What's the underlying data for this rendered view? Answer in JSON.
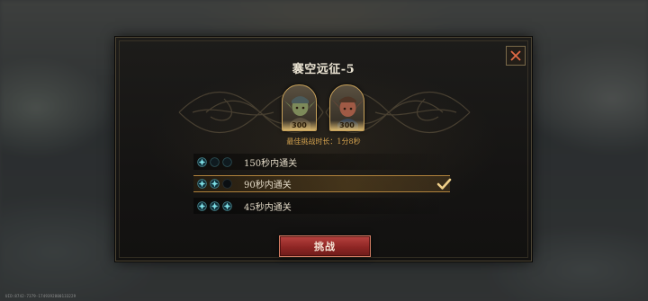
{
  "dialog": {
    "title": "褰空远征-5",
    "best_time": "最佳挑战时长：1分8秒"
  },
  "heroes": [
    {
      "icon": "goblin-warrior-portrait-icon",
      "power": "300"
    },
    {
      "icon": "goblin-rogue-portrait-icon",
      "power": "300"
    }
  ],
  "conditions": [
    {
      "label": "150秒内通关",
      "stars_filled": 1,
      "stars_total": 3,
      "selected": false
    },
    {
      "label": "90秒内通关",
      "stars_filled": 2,
      "stars_total": 3,
      "selected": true
    },
    {
      "label": "45秒内通关",
      "stars_filled": 3,
      "stars_total": 3,
      "selected": false
    }
  ],
  "buttons": {
    "challenge": "挑战",
    "close_icon": "close-x-icon"
  },
  "footer": {
    "build_code": "UID:8742-7379-1749392800133229"
  },
  "colors": {
    "accent_gold": "#d4a24e",
    "gem_teal": "#6fd0d6",
    "button_red": "#8e2624"
  }
}
